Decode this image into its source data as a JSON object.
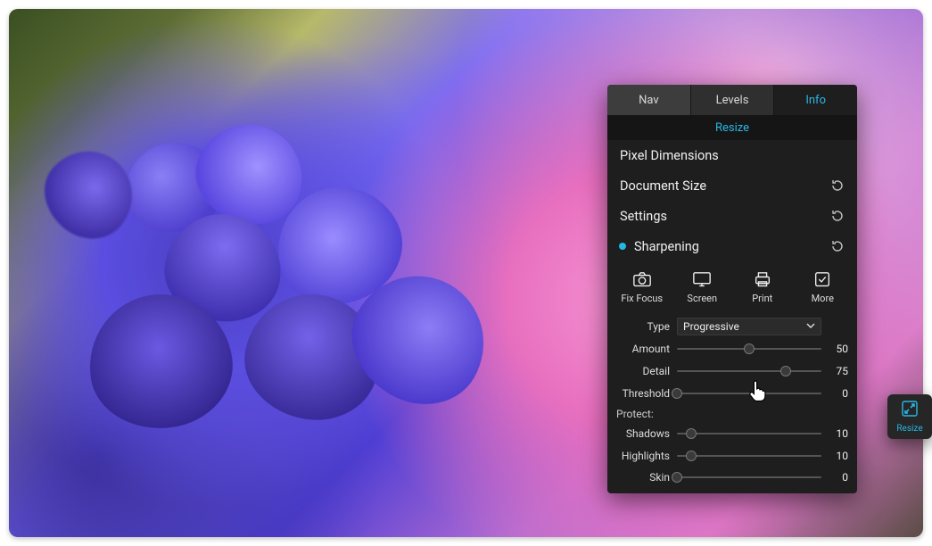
{
  "colors": {
    "accent": "#29b7e6"
  },
  "panel": {
    "tabs": {
      "nav": "Nav",
      "levels": "Levels",
      "info": "Info",
      "active": "info"
    },
    "section_title": "Resize",
    "rows": {
      "pixel_dimensions": "Pixel Dimensions",
      "document_size": "Document Size",
      "settings": "Settings",
      "sharpening": "Sharpening"
    },
    "buttons": {
      "fix_focus": "Fix Focus",
      "screen": "Screen",
      "print": "Print",
      "more": "More"
    },
    "type": {
      "label": "Type",
      "value": "Progressive"
    },
    "sliders": {
      "amount": {
        "label": "Amount",
        "value": 50,
        "min": 0,
        "max": 100
      },
      "detail": {
        "label": "Detail",
        "value": 75,
        "min": 0,
        "max": 100
      },
      "threshold": {
        "label": "Threshold",
        "value": 0,
        "min": 0,
        "max": 100
      }
    },
    "protect": {
      "heading": "Protect:",
      "shadows": {
        "label": "Shadows",
        "value": 10,
        "min": 0,
        "max": 100
      },
      "highlights": {
        "label": "Highlights",
        "value": 10,
        "min": 0,
        "max": 100
      },
      "skin": {
        "label": "Skin",
        "value": 0,
        "min": 0,
        "max": 100
      }
    }
  },
  "tile": {
    "label": "Resize"
  }
}
